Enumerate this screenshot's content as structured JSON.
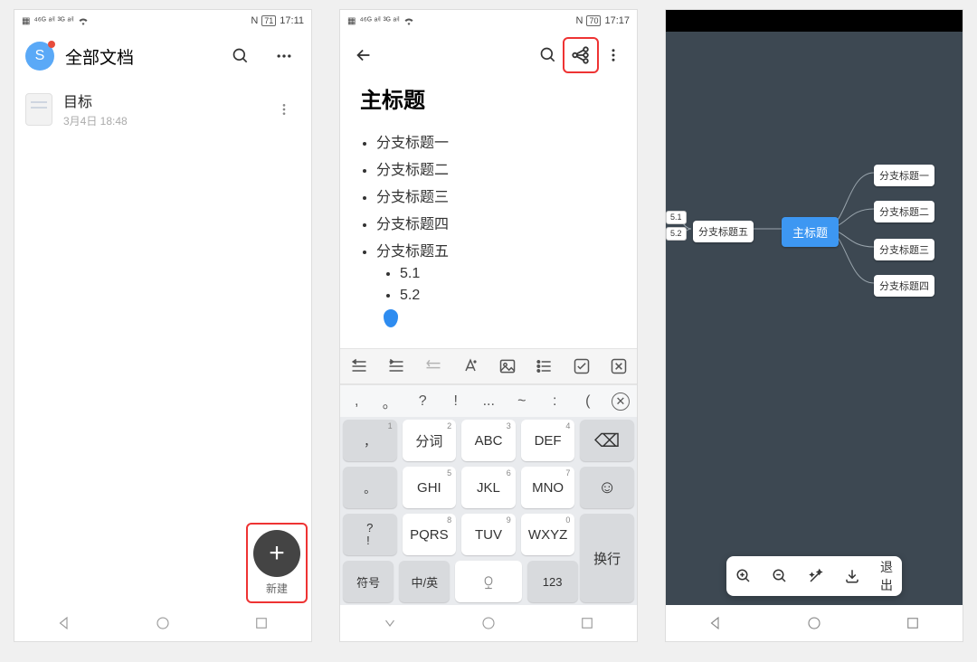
{
  "screen1": {
    "status": {
      "time": "17:11",
      "battery": "71",
      "nfc": "N"
    },
    "header_title": "全部文档",
    "avatar_letter": "S",
    "doc": {
      "name": "目标",
      "date": "3月4日 18:48"
    },
    "fab_label": "新建"
  },
  "screen2": {
    "status": {
      "time": "17:17",
      "battery": "70",
      "nfc": "N"
    },
    "title": "主标题",
    "bullets": [
      "分支标题一",
      "分支标题二",
      "分支标题三",
      "分支标题四",
      "分支标题五"
    ],
    "sub_bullets": [
      "5.1",
      "5.2"
    ],
    "punct_row": [
      ",",
      "。",
      "?",
      "!",
      "...",
      "~",
      ":",
      "("
    ],
    "keys": {
      "r1": [
        {
          "m": "，",
          "sup": "1"
        },
        {
          "m": "分词",
          "sup": "2"
        },
        {
          "m": "ABC",
          "sup": "3"
        },
        {
          "m": "DEF",
          "sup": "4"
        }
      ],
      "r2": [
        {
          "m": "。",
          "sup": ""
        },
        {
          "m": "GHI",
          "sup": "5"
        },
        {
          "m": "JKL",
          "sup": "6"
        },
        {
          "m": "MNO",
          "sup": "7"
        }
      ],
      "r3": [
        {
          "m": "?\n!",
          "sup": ""
        },
        {
          "m": "PQRS",
          "sup": "8"
        },
        {
          "m": "TUV",
          "sup": "9"
        },
        {
          "m": "WXYZ",
          "sup": "0"
        }
      ],
      "r4": [
        "符号",
        "中/英",
        "",
        "123"
      ],
      "backspace": "⌫",
      "emoji": "☺",
      "enter": "换行"
    }
  },
  "screen3": {
    "status": {
      "time": ""
    },
    "root": "主标题",
    "right_nodes": [
      "分支标题一",
      "分支标题二",
      "分支标题三",
      "分支标题四"
    ],
    "left_node": "分支标题五",
    "left_subs": [
      "5.1",
      "5.2"
    ],
    "toolbar_exit": "退出"
  }
}
